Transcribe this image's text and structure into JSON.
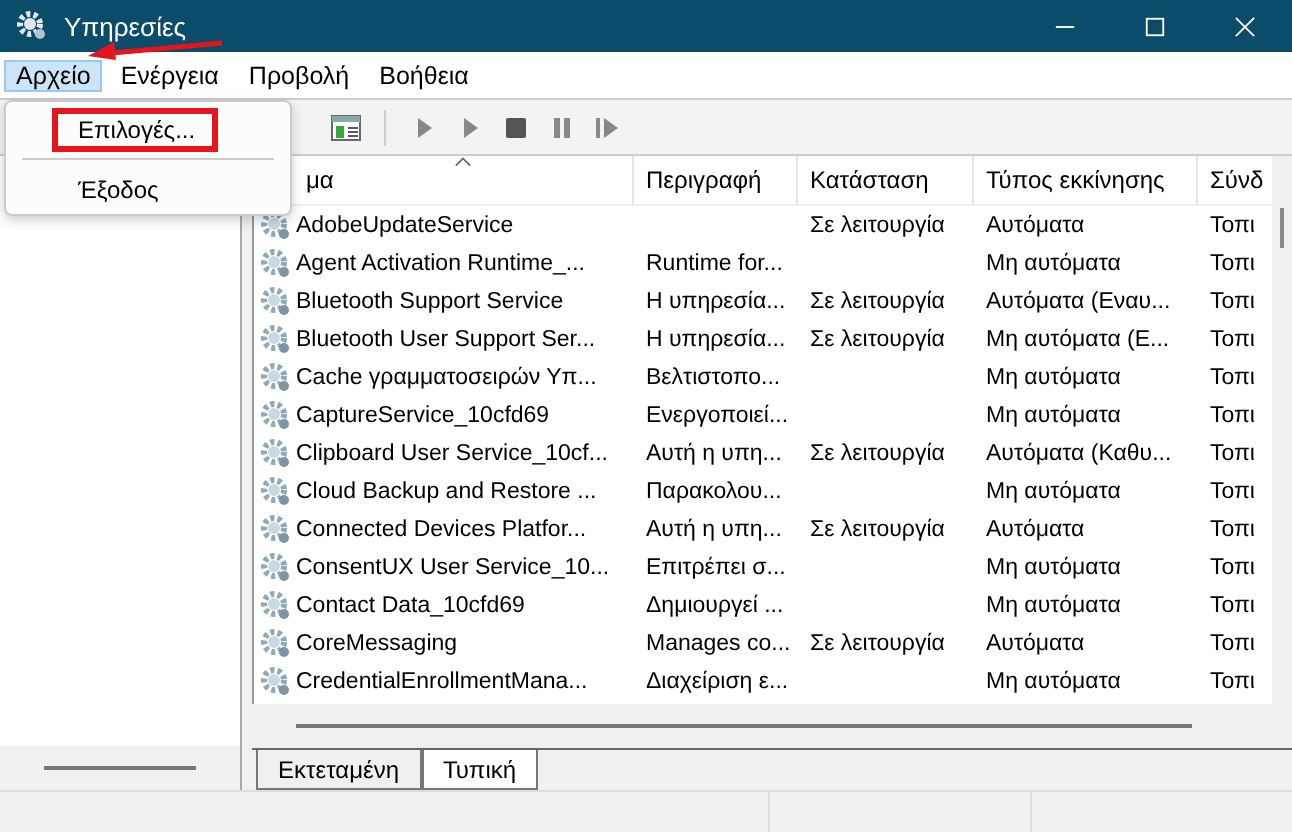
{
  "window": {
    "title": "Υπηρεσίες"
  },
  "menu_bar": [
    {
      "label": "Αρχείο",
      "selected": true
    },
    {
      "label": "Ενέργεια",
      "selected": false
    },
    {
      "label": "Προβολή",
      "selected": false
    },
    {
      "label": "Βοήθεια",
      "selected": false
    }
  ],
  "dropdown": [
    {
      "label": "Επιλογές...",
      "highlighted": true
    },
    {
      "label": "Έξοδος",
      "highlighted": false
    }
  ],
  "table": {
    "columns": [
      "μα",
      "Περιγραφή",
      "Κατάσταση",
      "Τύπος εκκίνησης",
      "Σύνδ"
    ],
    "rows": [
      {
        "name": "AdobeUpdateService",
        "description": "",
        "status": "Σε λειτουργία",
        "startup": "Αυτόματα",
        "logon": "Τοπι"
      },
      {
        "name": "Agent Activation Runtime_...",
        "description": "Runtime for...",
        "status": "",
        "startup": "Μη αυτόματα",
        "logon": "Τοπι"
      },
      {
        "name": "Bluetooth Support Service",
        "description": "Η υπηρεσία...",
        "status": "Σε λειτουργία",
        "startup": "Αυτόματα (Εναυ...",
        "logon": "Τοπι"
      },
      {
        "name": "Bluetooth User Support Ser...",
        "description": "Η υπηρεσία...",
        "status": "Σε λειτουργία",
        "startup": "Μη αυτόματα (Ε...",
        "logon": "Τοπι"
      },
      {
        "name": "Cache γραμματοσειρών Υπ...",
        "description": "Βελτιστοπο...",
        "status": "",
        "startup": "Μη αυτόματα",
        "logon": "Τοπι"
      },
      {
        "name": "CaptureService_10cfd69",
        "description": "Ενεργοποιεί...",
        "status": "",
        "startup": "Μη αυτόματα",
        "logon": "Τοπι"
      },
      {
        "name": "Clipboard User Service_10cf...",
        "description": "Αυτή η υπη...",
        "status": "Σε λειτουργία",
        "startup": "Αυτόματα (Καθυ...",
        "logon": "Τοπι"
      },
      {
        "name": "Cloud Backup and Restore ...",
        "description": "Παρακολου...",
        "status": "",
        "startup": "Μη αυτόματα",
        "logon": "Τοπι"
      },
      {
        "name": "Connected Devices Platfor...",
        "description": "Αυτή η υπη...",
        "status": "Σε λειτουργία",
        "startup": "Αυτόματα",
        "logon": "Τοπι"
      },
      {
        "name": "ConsentUX User Service_10...",
        "description": "Επιτρέπει σ...",
        "status": "",
        "startup": "Μη αυτόματα",
        "logon": "Τοπι"
      },
      {
        "name": "Contact Data_10cfd69",
        "description": "Δημιουργεί ...",
        "status": "",
        "startup": "Μη αυτόματα",
        "logon": "Τοπι"
      },
      {
        "name": "CoreMessaging",
        "description": "Manages co...",
        "status": "Σε λειτουργία",
        "startup": "Αυτόματα",
        "logon": "Τοπι"
      },
      {
        "name": "CredentialEnrollmentMana...",
        "description": "Διαχείριση ε...",
        "status": "",
        "startup": "Μη αυτόματα",
        "logon": "Τοπι"
      }
    ]
  },
  "tabs": [
    {
      "label": "Εκτεταμένη",
      "selected": false
    },
    {
      "label": "Τυπική",
      "selected": true
    }
  ]
}
